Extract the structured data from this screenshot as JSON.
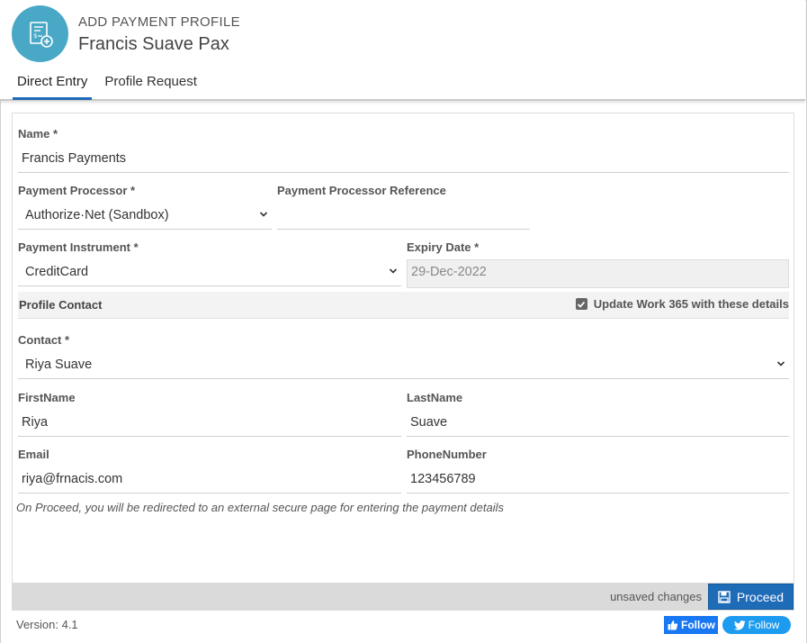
{
  "header": {
    "icon": "payment-profile-icon",
    "subtitle": "ADD PAYMENT PROFILE",
    "title": "Francis Suave Pax",
    "accent_color": "#4aa8c7"
  },
  "tabs": [
    {
      "label": "Direct Entry",
      "active": true
    },
    {
      "label": "Profile Request",
      "active": false
    }
  ],
  "form": {
    "name": {
      "label": "Name *",
      "value": "Francis Payments"
    },
    "payment_processor": {
      "label": "Payment Processor *",
      "value": "Authorize·Net (Sandbox)"
    },
    "processor_reference": {
      "label": "Payment Processor Reference",
      "value": ""
    },
    "payment_instrument": {
      "label": "Payment Instrument *",
      "value": "CreditCard"
    },
    "expiry_date": {
      "label": "Expiry Date *",
      "value": "29-Dec-2022"
    },
    "profile_contact": {
      "section_title": "Profile Contact",
      "update_checkbox_label": "Update Work 365 with these details",
      "update_checked": true
    },
    "contact": {
      "label": "Contact *",
      "value": "Riya Suave"
    },
    "first_name": {
      "label": "FirstName",
      "value": "Riya"
    },
    "last_name": {
      "label": "LastName",
      "value": "Suave"
    },
    "email": {
      "label": "Email",
      "value": "riya@frnacis.com"
    },
    "phone": {
      "label": "PhoneNumber",
      "value": "123456789"
    },
    "note": "On Proceed, you will be redirected to an external secure page for entering the payment details"
  },
  "footer": {
    "status": "unsaved changes",
    "proceed_label": "Proceed",
    "primary_color": "#1e6bb8"
  },
  "version": "Version: 4.1",
  "social": {
    "facebook_label": "Follow",
    "twitter_label": "Follow"
  }
}
